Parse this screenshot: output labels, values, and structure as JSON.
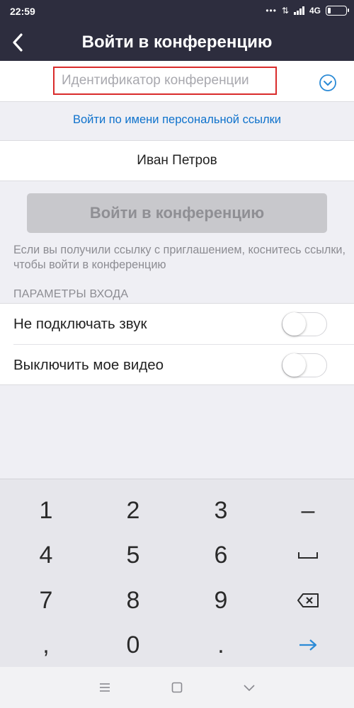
{
  "status_bar": {
    "time": "22:59",
    "network": "4G",
    "battery_level": 0.15
  },
  "header": {
    "title": "Войти в конференцию",
    "back_icon": "chevron-left-icon"
  },
  "meeting_id": {
    "placeholder": "Идентификатор конференции",
    "value": "",
    "dropdown_icon": "chevron-down-circle-icon"
  },
  "personal_link_label": "Войти по имени персональной ссылки",
  "name_field": {
    "value": "Иван Петров"
  },
  "join_button_label": "Войти в конференцию",
  "hint_text": "Если вы получили ссылку с приглашением, коснитесь ссылки, чтобы войти в конференцию",
  "section_title": "ПАРАМЕТРЫ ВХОДА",
  "options": [
    {
      "label": "Не подключать звук",
      "enabled": false
    },
    {
      "label": "Выключить мое видео",
      "enabled": false
    }
  ],
  "keyboard": {
    "keys": [
      "1",
      "2",
      "3",
      "–",
      "4",
      "5",
      "6",
      "space",
      "7",
      "8",
      "9",
      "backspace",
      ",",
      "0",
      ".",
      "enter"
    ]
  },
  "colors": {
    "header_bg": "#2d2d3e",
    "link": "#0e72cc",
    "highlight": "#d92b2b",
    "enter_key": "#2a8ad6"
  }
}
